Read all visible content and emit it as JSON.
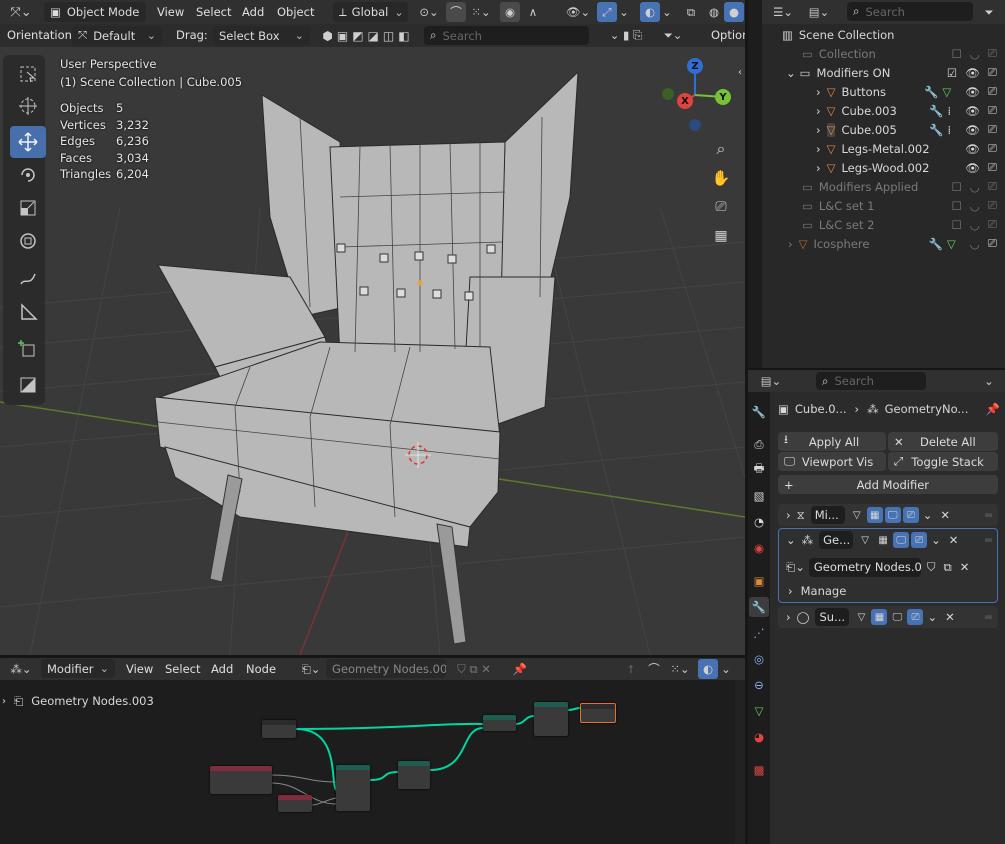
{
  "viewport_header": {
    "mode": "Object Mode",
    "menus": [
      "View",
      "Select",
      "Add",
      "Object"
    ],
    "transform_orientation": "Global"
  },
  "tool_settings": {
    "orientation_label": "Orientation:",
    "orientation_value": "Default",
    "drag_label": "Drag:",
    "drag_value": "Select Box",
    "search_placeholder": "Search",
    "options_label": "Option"
  },
  "viewport_overlay": {
    "perspective": "User Perspective",
    "context": "(1) Scene Collection | Cube.005",
    "stats": [
      {
        "label": "Objects",
        "value": "5"
      },
      {
        "label": "Vertices",
        "value": "3,232"
      },
      {
        "label": "Edges",
        "value": "6,236"
      },
      {
        "label": "Faces",
        "value": "3,034"
      },
      {
        "label": "Triangles",
        "value": "6,204"
      }
    ],
    "gizmo": {
      "x": "X",
      "y": "Y",
      "z": "Z"
    }
  },
  "outliner": {
    "search_placeholder": "Search",
    "items": [
      {
        "label": "Scene Collection"
      },
      {
        "label": "Collection"
      },
      {
        "label": "Modifiers ON"
      },
      {
        "label": "Buttons"
      },
      {
        "label": "Cube.003"
      },
      {
        "label": "Cube.005"
      },
      {
        "label": "Legs-Metal.002"
      },
      {
        "label": "Legs-Wood.002"
      },
      {
        "label": "Modifiers Applied"
      },
      {
        "label": "L&C set 1"
      },
      {
        "label": "L&C set 2"
      },
      {
        "label": "Icosphere"
      }
    ]
  },
  "properties": {
    "search_placeholder": "Search",
    "breadcrumb_object": "Cube.0...",
    "breadcrumb_modifier": "GeometryNo...",
    "apply_all": "Apply All",
    "delete_all": "Delete All",
    "viewport_vis": "Viewport Vis",
    "toggle_stack": "Toggle Stack",
    "add_modifier": "Add Modifier",
    "modifiers": [
      {
        "name": "Mi..."
      },
      {
        "name": "Ge..."
      },
      {
        "name": "Su..."
      }
    ],
    "node_group": "Geometry Nodes.0...",
    "manage": "Manage"
  },
  "node_editor": {
    "editor_type": "Modifier",
    "menus": [
      "View",
      "Select",
      "Add",
      "Node"
    ],
    "node_tree": "Geometry Nodes.003",
    "breadcrumb": "Geometry Nodes.003"
  },
  "colors": {
    "accent_blue": "#4772b3",
    "axis_x": "#e0433f",
    "axis_y": "#77c236",
    "axis_z": "#2e6fd6",
    "object_orange": "#e08a3c"
  }
}
